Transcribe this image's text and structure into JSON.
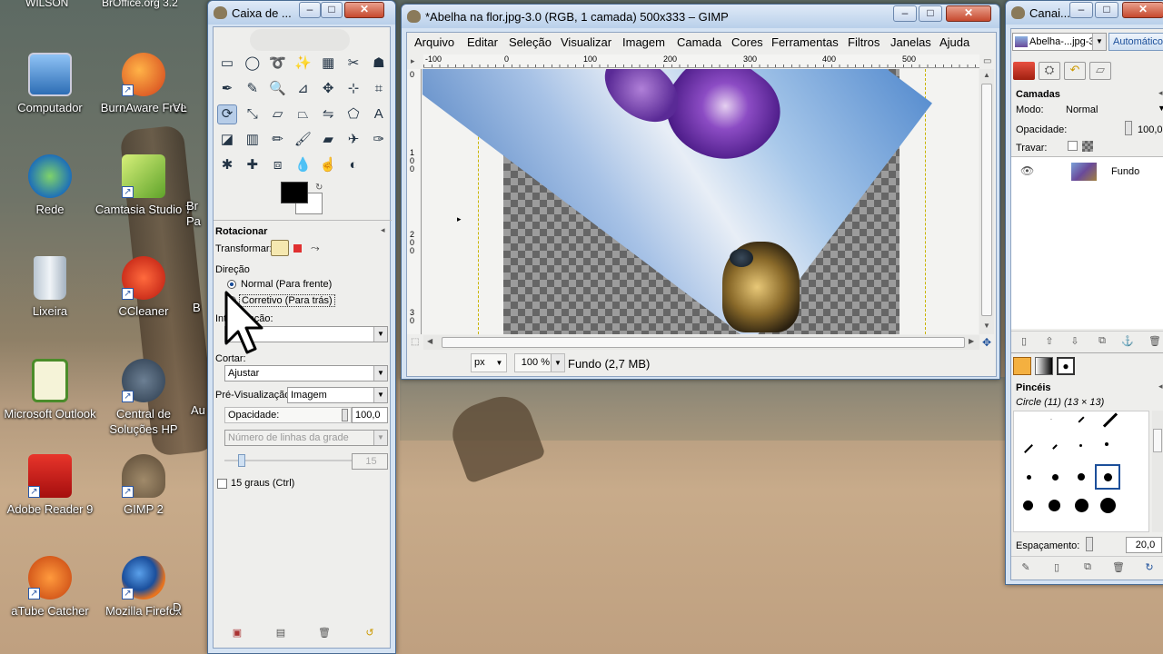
{
  "desktop": {
    "top_labels": [
      "WILSON",
      "BrOffice.org 3.2"
    ],
    "icons": [
      {
        "label": "Computador",
        "icon": "computer-icon"
      },
      {
        "label": "BurnAware Free",
        "icon": "burnaware-icon"
      },
      {
        "label": "VL",
        "icon": "partial-icon"
      },
      {
        "label": "Rede",
        "icon": "network-icon"
      },
      {
        "label": "Camtasia Studio 7",
        "icon": "camtasia-icon"
      },
      {
        "label": "Br Pa",
        "icon": "partial-icon"
      },
      {
        "label": "Lixeira",
        "icon": "recycle-bin-icon"
      },
      {
        "label": "CCleaner",
        "icon": "ccleaner-icon"
      },
      {
        "label": "B",
        "icon": "partial-icon"
      },
      {
        "label": "Microsoft Outlook",
        "icon": "outlook-icon"
      },
      {
        "label": "Central de Soluções HP",
        "icon": "hp-icon"
      },
      {
        "label": "Au",
        "icon": "partial-icon"
      },
      {
        "label": "Adobe Reader 9",
        "icon": "adobe-reader-icon"
      },
      {
        "label": "GIMP 2",
        "icon": "gimp-icon"
      },
      {
        "label": "aTube Catcher",
        "icon": "atube-catcher-icon"
      },
      {
        "label": "Mozilla Firefox",
        "icon": "firefox-icon"
      },
      {
        "label": "D",
        "icon": "partial-icon"
      }
    ]
  },
  "toolbox": {
    "title": "Caixa de ...",
    "panel_title": "Rotacionar",
    "transformar_label": "Transformar:",
    "direcao_label": "Direção",
    "dir_normal": "Normal (Para frente)",
    "dir_corretivo": "Corretivo (Para trás)",
    "interpolacao_label": "Interpolação:",
    "interpolacao_value": "",
    "cortar_label": "Cortar:",
    "cortar_value": "Ajustar",
    "previsualizacao_label": "Pré-Visualização:",
    "previsualizacao_value": "Imagem",
    "opacidade_label": "Opacidade:",
    "opacidade_value": "100,0",
    "opacidade_fraction": 1.0,
    "grade_placeholder": "Número de linhas da grade",
    "grade_value": "15",
    "graus_label": "15 graus (Ctrl)",
    "fg_color": "#000000",
    "bg_color": "#ffffff"
  },
  "image_window": {
    "title": "*Abelha na flor.jpg-3.0 (RGB, 1 camada) 500x333 – GIMP",
    "menu": [
      "Arquivo",
      "Editar",
      "Seleção",
      "Visualizar",
      "Imagem",
      "Camada",
      "Cores",
      "Ferramentas",
      "Filtros",
      "Janelas",
      "Ajuda"
    ],
    "ruler_h": [
      "-100",
      "0",
      "100",
      "200",
      "300",
      "400",
      "500"
    ],
    "ruler_v": [
      "0",
      "1\n0\n0",
      "2\n0\n0",
      "3\n0"
    ],
    "unit": "px",
    "zoom": "100 %",
    "status": "Fundo (2,7 MB)"
  },
  "layers": {
    "title": "Canai...",
    "image_combo": "Abelha-...jpg-3",
    "auto_button": "Automático",
    "camadas_label": "Camadas",
    "modo_label": "Modo:",
    "modo_value": "Normal",
    "opacidade_label": "Opacidade:",
    "opacidade_value": "100,0",
    "travar_label": "Travar:",
    "layer_name": "Fundo",
    "pinceis_label": "Pincéis",
    "brush_name": "Circle (11) (13 × 13)",
    "espacamento_label": "Espaçamento:",
    "espacamento_value": "20,0"
  }
}
